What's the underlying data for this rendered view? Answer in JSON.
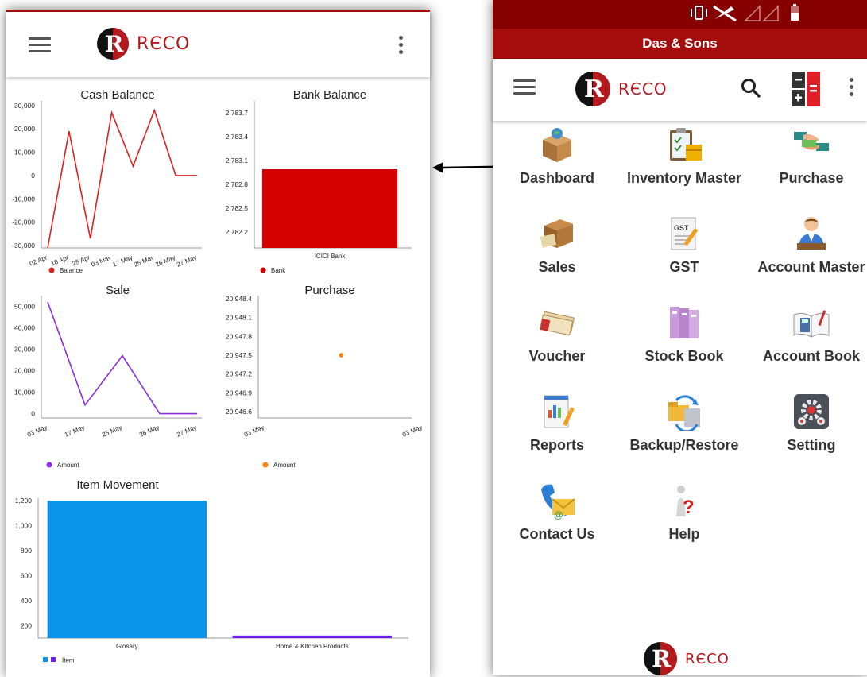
{
  "left_screen": {
    "app_logo_text": "RЄCO",
    "charts": [
      {
        "id": "cash",
        "title": "Cash Balance",
        "type": "line",
        "color": "#e02020",
        "x": [
          "02 Apr",
          "18 Apr",
          "25 Apr",
          "03 May",
          "17 May",
          "25 May",
          "26 May",
          "27 May"
        ],
        "values": [
          -31000,
          19000,
          -27000,
          27000,
          4000,
          28000,
          0,
          0
        ],
        "yticks": [
          "30,000",
          "20,000",
          "10,000",
          "0",
          "-10,000",
          "-20,000",
          "-30,000"
        ],
        "ylim": [
          -31000,
          32000
        ],
        "legend": "Balance"
      },
      {
        "id": "bank",
        "title": "Bank Balance",
        "type": "bar",
        "color": "#d50000",
        "categories": [
          "ICICI Bank"
        ],
        "values": [
          2782.99
        ],
        "yticks": [
          "2,783.7",
          "2,783.4",
          "2,783.1",
          "2,782.8",
          "2,782.5",
          "2,782.2"
        ],
        "ylim": [
          2782.0,
          2783.85
        ],
        "legend": "Bank"
      },
      {
        "id": "sale",
        "title": "Sale",
        "type": "line",
        "color": "#8a2be2",
        "x": [
          "03 May",
          "17 May",
          "25 May",
          "26 May",
          "27 May"
        ],
        "values": [
          52000,
          4000,
          27000,
          0,
          0
        ],
        "yticks": [
          "50,000",
          "40,000",
          "30,000",
          "20,000",
          "10,000",
          "0"
        ],
        "ylim": [
          -2000,
          55000
        ],
        "legend": "Amount"
      },
      {
        "id": "purchase",
        "title": "Purchase",
        "type": "scatter",
        "color": "#ff7f0e",
        "x": [
          "03 May",
          "03 May"
        ],
        "values": [
          20947.5
        ],
        "yticks": [
          "20,948.4",
          "20,948.1",
          "20,947.8",
          "20,947.5",
          "20,947.2",
          "20,946.9",
          "20,946.6"
        ],
        "ylim": [
          20946.5,
          20948.45
        ],
        "legend": "Amount"
      },
      {
        "id": "item",
        "title": "Item Movement",
        "type": "bar",
        "categories": [
          "Glosary",
          "Home & Kitchen Products"
        ],
        "values": [
          1200,
          120
        ],
        "colors": [
          "#0b94e8",
          "#6f1bea"
        ],
        "yticks": [
          "1,200",
          "1,000",
          "800",
          "600",
          "400",
          "200"
        ],
        "ylim": [
          100,
          1220
        ],
        "legend": "Item"
      }
    ]
  },
  "right_screen": {
    "company_name": "Das & Sons",
    "app_logo_text": "RЄCO",
    "footer_logo_text": "RЄCO",
    "menu": [
      {
        "label": "Dashboard",
        "icon": "box-globe-icon"
      },
      {
        "label": "Inventory Master",
        "icon": "clipboard-inventory-icon"
      },
      {
        "label": "Purchase",
        "icon": "handshake-money-icon"
      },
      {
        "label": "Sales",
        "icon": "package-cash-icon"
      },
      {
        "label": "GST",
        "icon": "gst-document-icon"
      },
      {
        "label": "Account Master",
        "icon": "accountant-icon"
      },
      {
        "label": "Voucher",
        "icon": "cheque-icon"
      },
      {
        "label": "Stock Book",
        "icon": "binders-icon"
      },
      {
        "label": "Account Book",
        "icon": "open-book-calculator-icon"
      },
      {
        "label": "Reports",
        "icon": "report-chart-icon"
      },
      {
        "label": "Backup/Restore",
        "icon": "folder-sync-icon"
      },
      {
        "label": "Setting",
        "icon": "gears-icon"
      },
      {
        "label": "Contact Us",
        "icon": "phone-mail-icon"
      },
      {
        "label": "Help",
        "icon": "question-person-icon"
      }
    ]
  },
  "colors": {
    "brand_dark": "#870000",
    "brand": "#a50d0d",
    "logo_red": "#b3191d"
  }
}
